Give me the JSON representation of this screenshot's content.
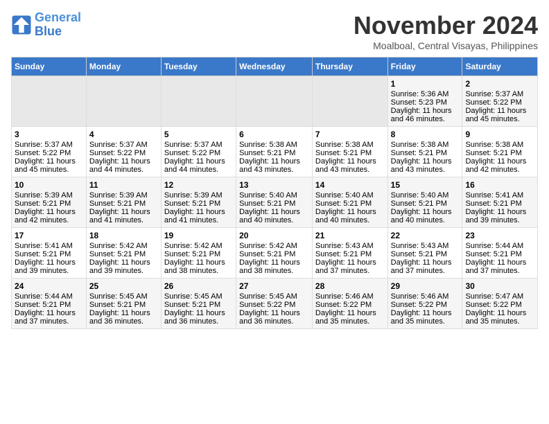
{
  "header": {
    "logo_line1": "General",
    "logo_line2": "Blue",
    "month": "November 2024",
    "location": "Moalboal, Central Visayas, Philippines"
  },
  "weekdays": [
    "Sunday",
    "Monday",
    "Tuesday",
    "Wednesday",
    "Thursday",
    "Friday",
    "Saturday"
  ],
  "weeks": [
    [
      {
        "day": "",
        "empty": true
      },
      {
        "day": "",
        "empty": true
      },
      {
        "day": "",
        "empty": true
      },
      {
        "day": "",
        "empty": true
      },
      {
        "day": "",
        "empty": true
      },
      {
        "day": "1",
        "sunrise": "Sunrise: 5:36 AM",
        "sunset": "Sunset: 5:23 PM",
        "daylight": "Daylight: 11 hours and 46 minutes."
      },
      {
        "day": "2",
        "sunrise": "Sunrise: 5:37 AM",
        "sunset": "Sunset: 5:22 PM",
        "daylight": "Daylight: 11 hours and 45 minutes."
      }
    ],
    [
      {
        "day": "3",
        "sunrise": "Sunrise: 5:37 AM",
        "sunset": "Sunset: 5:22 PM",
        "daylight": "Daylight: 11 hours and 45 minutes."
      },
      {
        "day": "4",
        "sunrise": "Sunrise: 5:37 AM",
        "sunset": "Sunset: 5:22 PM",
        "daylight": "Daylight: 11 hours and 44 minutes."
      },
      {
        "day": "5",
        "sunrise": "Sunrise: 5:37 AM",
        "sunset": "Sunset: 5:22 PM",
        "daylight": "Daylight: 11 hours and 44 minutes."
      },
      {
        "day": "6",
        "sunrise": "Sunrise: 5:38 AM",
        "sunset": "Sunset: 5:21 PM",
        "daylight": "Daylight: 11 hours and 43 minutes."
      },
      {
        "day": "7",
        "sunrise": "Sunrise: 5:38 AM",
        "sunset": "Sunset: 5:21 PM",
        "daylight": "Daylight: 11 hours and 43 minutes."
      },
      {
        "day": "8",
        "sunrise": "Sunrise: 5:38 AM",
        "sunset": "Sunset: 5:21 PM",
        "daylight": "Daylight: 11 hours and 43 minutes."
      },
      {
        "day": "9",
        "sunrise": "Sunrise: 5:38 AM",
        "sunset": "Sunset: 5:21 PM",
        "daylight": "Daylight: 11 hours and 42 minutes."
      }
    ],
    [
      {
        "day": "10",
        "sunrise": "Sunrise: 5:39 AM",
        "sunset": "Sunset: 5:21 PM",
        "daylight": "Daylight: 11 hours and 42 minutes."
      },
      {
        "day": "11",
        "sunrise": "Sunrise: 5:39 AM",
        "sunset": "Sunset: 5:21 PM",
        "daylight": "Daylight: 11 hours and 41 minutes."
      },
      {
        "day": "12",
        "sunrise": "Sunrise: 5:39 AM",
        "sunset": "Sunset: 5:21 PM",
        "daylight": "Daylight: 11 hours and 41 minutes."
      },
      {
        "day": "13",
        "sunrise": "Sunrise: 5:40 AM",
        "sunset": "Sunset: 5:21 PM",
        "daylight": "Daylight: 11 hours and 40 minutes."
      },
      {
        "day": "14",
        "sunrise": "Sunrise: 5:40 AM",
        "sunset": "Sunset: 5:21 PM",
        "daylight": "Daylight: 11 hours and 40 minutes."
      },
      {
        "day": "15",
        "sunrise": "Sunrise: 5:40 AM",
        "sunset": "Sunset: 5:21 PM",
        "daylight": "Daylight: 11 hours and 40 minutes."
      },
      {
        "day": "16",
        "sunrise": "Sunrise: 5:41 AM",
        "sunset": "Sunset: 5:21 PM",
        "daylight": "Daylight: 11 hours and 39 minutes."
      }
    ],
    [
      {
        "day": "17",
        "sunrise": "Sunrise: 5:41 AM",
        "sunset": "Sunset: 5:21 PM",
        "daylight": "Daylight: 11 hours and 39 minutes."
      },
      {
        "day": "18",
        "sunrise": "Sunrise: 5:42 AM",
        "sunset": "Sunset: 5:21 PM",
        "daylight": "Daylight: 11 hours and 39 minutes."
      },
      {
        "day": "19",
        "sunrise": "Sunrise: 5:42 AM",
        "sunset": "Sunset: 5:21 PM",
        "daylight": "Daylight: 11 hours and 38 minutes."
      },
      {
        "day": "20",
        "sunrise": "Sunrise: 5:42 AM",
        "sunset": "Sunset: 5:21 PM",
        "daylight": "Daylight: 11 hours and 38 minutes."
      },
      {
        "day": "21",
        "sunrise": "Sunrise: 5:43 AM",
        "sunset": "Sunset: 5:21 PM",
        "daylight": "Daylight: 11 hours and 37 minutes."
      },
      {
        "day": "22",
        "sunrise": "Sunrise: 5:43 AM",
        "sunset": "Sunset: 5:21 PM",
        "daylight": "Daylight: 11 hours and 37 minutes."
      },
      {
        "day": "23",
        "sunrise": "Sunrise: 5:44 AM",
        "sunset": "Sunset: 5:21 PM",
        "daylight": "Daylight: 11 hours and 37 minutes."
      }
    ],
    [
      {
        "day": "24",
        "sunrise": "Sunrise: 5:44 AM",
        "sunset": "Sunset: 5:21 PM",
        "daylight": "Daylight: 11 hours and 37 minutes."
      },
      {
        "day": "25",
        "sunrise": "Sunrise: 5:45 AM",
        "sunset": "Sunset: 5:21 PM",
        "daylight": "Daylight: 11 hours and 36 minutes."
      },
      {
        "day": "26",
        "sunrise": "Sunrise: 5:45 AM",
        "sunset": "Sunset: 5:21 PM",
        "daylight": "Daylight: 11 hours and 36 minutes."
      },
      {
        "day": "27",
        "sunrise": "Sunrise: 5:45 AM",
        "sunset": "Sunset: 5:22 PM",
        "daylight": "Daylight: 11 hours and 36 minutes."
      },
      {
        "day": "28",
        "sunrise": "Sunrise: 5:46 AM",
        "sunset": "Sunset: 5:22 PM",
        "daylight": "Daylight: 11 hours and 35 minutes."
      },
      {
        "day": "29",
        "sunrise": "Sunrise: 5:46 AM",
        "sunset": "Sunset: 5:22 PM",
        "daylight": "Daylight: 11 hours and 35 minutes."
      },
      {
        "day": "30",
        "sunrise": "Sunrise: 5:47 AM",
        "sunset": "Sunset: 5:22 PM",
        "daylight": "Daylight: 11 hours and 35 minutes."
      }
    ]
  ]
}
